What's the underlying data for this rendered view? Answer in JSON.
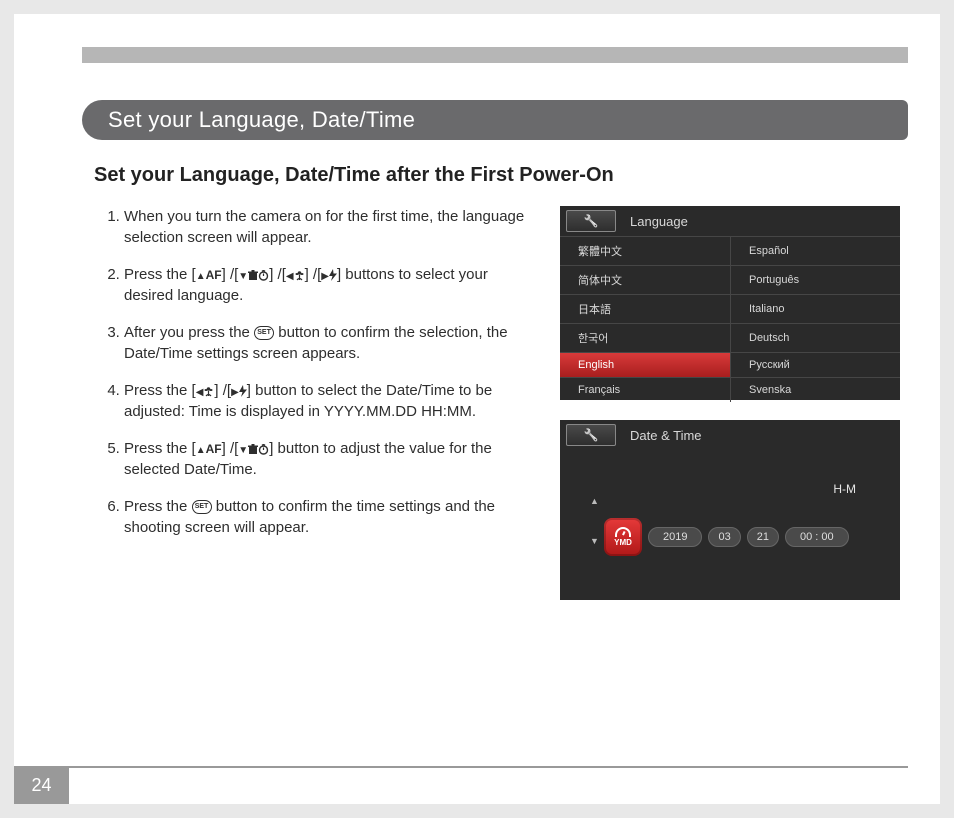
{
  "header": {
    "title": "Set your Language, Date/Time"
  },
  "subheading": "Set your Language, Date/Time after the First Power-On",
  "steps": [
    "When you turn the camera on for the first time, the language selection screen will appear.",
    "",
    "",
    "",
    "",
    ""
  ],
  "step2_prefix": "Press the [",
  "step2_mid1": "] /[",
  "step2_mid2": "] /[",
  "step2_mid3": "] /[",
  "step2_suffix": "] buttons to select your desired language.",
  "step3_prefix": "After you press the ",
  "step3_set": "SET",
  "step3_suffix": " button to confirm the selection, the Date/Time settings screen appears.",
  "step4_prefix": "Press the [",
  "step4_mid": "] /[",
  "step4_suffix": "] button to select the Date/Time to be adjusted: Time is displayed in YYYY.MM.DD HH:MM.",
  "step5_prefix": "Press the [",
  "step5_mid": "] /[",
  "step5_suffix": "] button to adjust the value for the selected Date/Time.",
  "step6_prefix": "Press the ",
  "step6_suffix": " button to confirm the time settings and the shooting screen will appear.",
  "af_label": "AF",
  "lang_screen": {
    "title": "Language",
    "items": [
      "繁體中文",
      "Español",
      "简体中文",
      "Português",
      "日本語",
      "Italiano",
      "한국어",
      "Deutsch",
      "English",
      "Русский",
      "Français",
      "Svenska"
    ],
    "selected": "English"
  },
  "dt_screen": {
    "title": "Date & Time",
    "hm": "H-M",
    "ymd": "YMD",
    "year": "2019",
    "month": "03",
    "day": "21",
    "time": "00 : 00"
  },
  "page_number": "24"
}
